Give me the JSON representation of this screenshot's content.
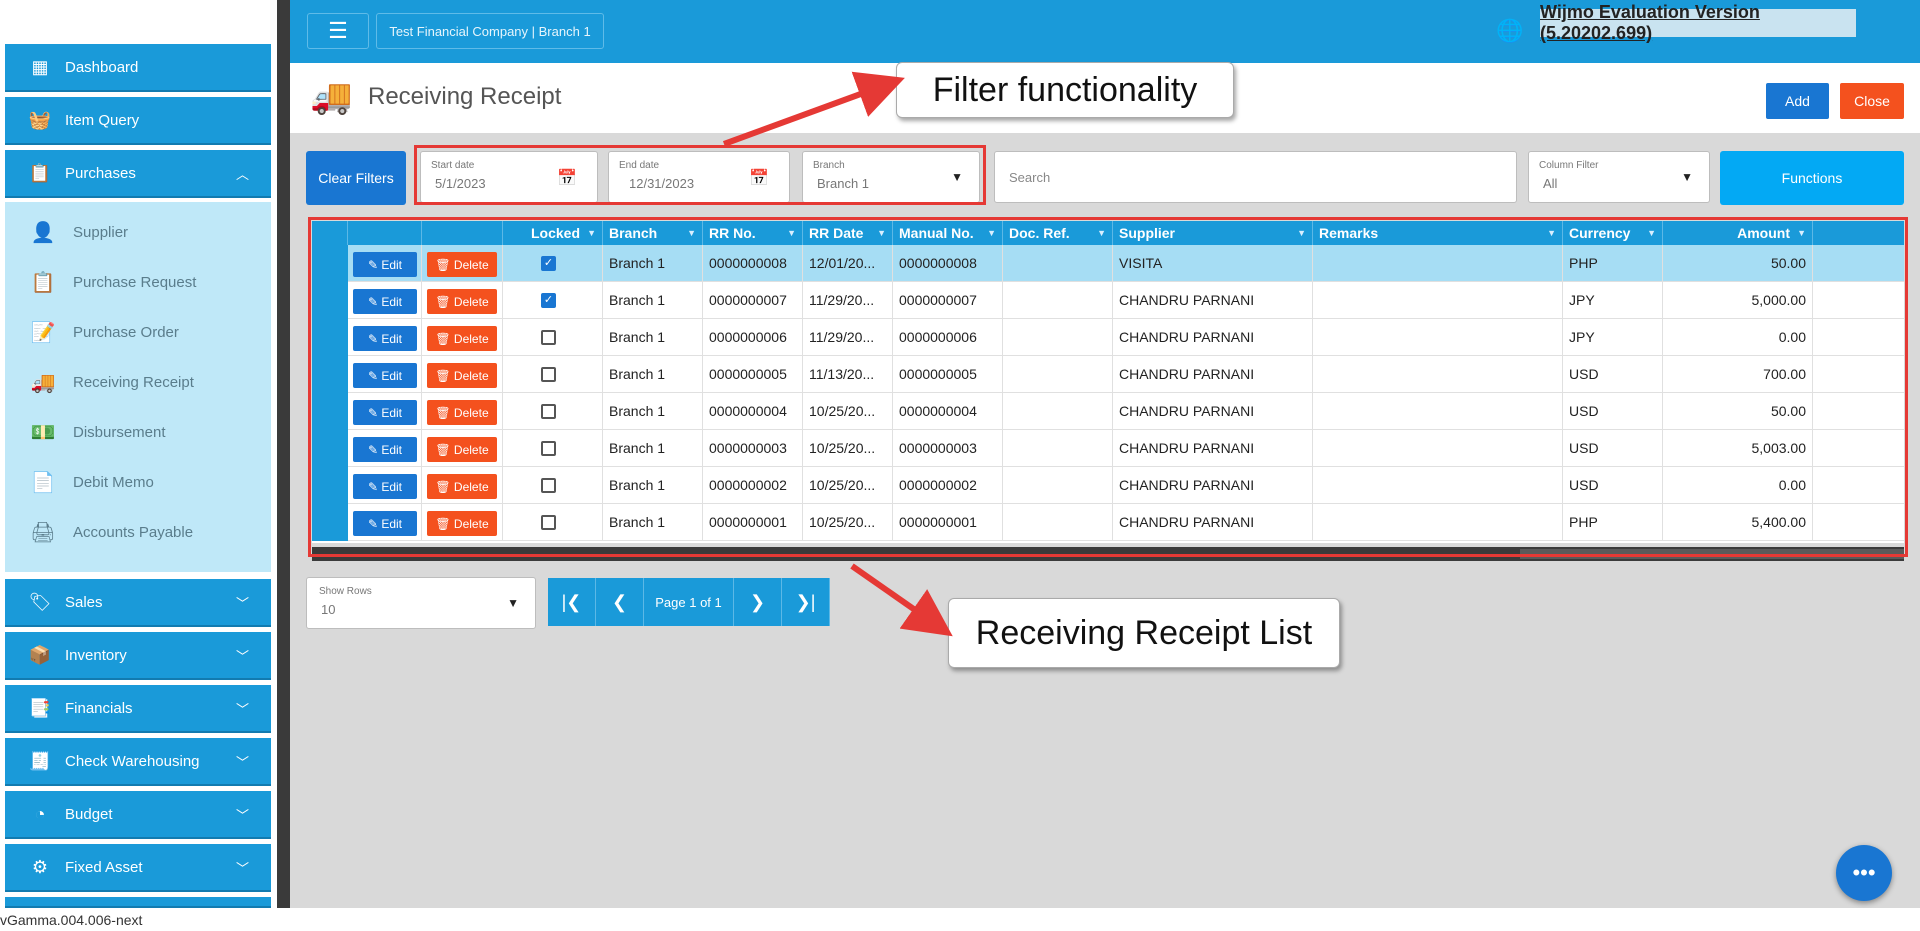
{
  "topbar": {
    "menu_icon": "hamburger-icon",
    "company": "Test Financial Company | Branch 1",
    "globe_icon": "globe-icon",
    "watermark": "Wijmo Evaluation Version (5.20202.699)"
  },
  "sidebar": {
    "dashboard": "Dashboard",
    "item_query": "Item Query",
    "purchases": "Purchases",
    "purchases_sub": [
      "Supplier",
      "Purchase Request",
      "Purchase Order",
      "Receiving Receipt",
      "Disbursement",
      "Debit Memo",
      "Accounts Payable"
    ],
    "sales": "Sales",
    "inventory": "Inventory",
    "financials": "Financials",
    "check_warehousing": "Check Warehousing",
    "budget": "Budget",
    "fixed_asset": "Fixed Asset"
  },
  "page": {
    "title": "Receiving Receipt",
    "add_label": "Add",
    "close_label": "Close"
  },
  "filters": {
    "clear_label": "Clear Filters",
    "start_date_label": "Start date",
    "start_date": "5/1/2023",
    "end_date_label": "End date",
    "end_date": "12/31/2023",
    "branch_label": "Branch",
    "branch": "Branch 1",
    "search_placeholder": "Search",
    "column_filter_label": "Column Filter",
    "column_filter": "All",
    "functions_label": "Functions"
  },
  "grid": {
    "headers": [
      "Locked",
      "Branch",
      "RR No.",
      "RR Date",
      "Manual No.",
      "Doc. Ref.",
      "Supplier",
      "Remarks",
      "Currency",
      "Amount"
    ],
    "edit_label": "Edit",
    "delete_label": "Delete",
    "rows": [
      {
        "locked": true,
        "branch": "Branch 1",
        "rr_no": "0000000008",
        "rr_date": "12/01/20...",
        "manual_no": "0000000008",
        "doc_ref": "",
        "supplier": "VISITA",
        "remarks": "",
        "currency": "PHP",
        "amount": "50.00"
      },
      {
        "locked": true,
        "branch": "Branch 1",
        "rr_no": "0000000007",
        "rr_date": "11/29/20...",
        "manual_no": "0000000007",
        "doc_ref": "",
        "supplier": "CHANDRU PARNANI",
        "remarks": "",
        "currency": "JPY",
        "amount": "5,000.00"
      },
      {
        "locked": false,
        "branch": "Branch 1",
        "rr_no": "0000000006",
        "rr_date": "11/29/20...",
        "manual_no": "0000000006",
        "doc_ref": "",
        "supplier": "CHANDRU PARNANI",
        "remarks": "",
        "currency": "JPY",
        "amount": "0.00"
      },
      {
        "locked": false,
        "branch": "Branch 1",
        "rr_no": "0000000005",
        "rr_date": "11/13/20...",
        "manual_no": "0000000005",
        "doc_ref": "",
        "supplier": "CHANDRU PARNANI",
        "remarks": "",
        "currency": "USD",
        "amount": "700.00"
      },
      {
        "locked": false,
        "branch": "Branch 1",
        "rr_no": "0000000004",
        "rr_date": "10/25/20...",
        "manual_no": "0000000004",
        "doc_ref": "",
        "supplier": "CHANDRU PARNANI",
        "remarks": "",
        "currency": "USD",
        "amount": "50.00"
      },
      {
        "locked": false,
        "branch": "Branch 1",
        "rr_no": "0000000003",
        "rr_date": "10/25/20...",
        "manual_no": "0000000003",
        "doc_ref": "",
        "supplier": "CHANDRU PARNANI",
        "remarks": "",
        "currency": "USD",
        "amount": "5,003.00"
      },
      {
        "locked": false,
        "branch": "Branch 1",
        "rr_no": "0000000002",
        "rr_date": "10/25/20...",
        "manual_no": "0000000002",
        "doc_ref": "",
        "supplier": "CHANDRU PARNANI",
        "remarks": "",
        "currency": "USD",
        "amount": "0.00"
      },
      {
        "locked": false,
        "branch": "Branch 1",
        "rr_no": "0000000001",
        "rr_date": "10/25/20...",
        "manual_no": "0000000001",
        "doc_ref": "",
        "supplier": "CHANDRU PARNANI",
        "remarks": "",
        "currency": "PHP",
        "amount": "5,400.00"
      }
    ]
  },
  "pager": {
    "show_rows_label": "Show Rows",
    "show_rows": "10",
    "page_label": "Page 1 of 1"
  },
  "annotations": {
    "filter": "Filter functionality",
    "list": "Receiving Receipt List"
  },
  "footer": {
    "version": "vGamma.004.006-next"
  },
  "colors": {
    "primary": "#1a9ad9",
    "button_blue": "#1976d2",
    "button_orange": "#f4511e",
    "annotation_red": "#e53935"
  }
}
